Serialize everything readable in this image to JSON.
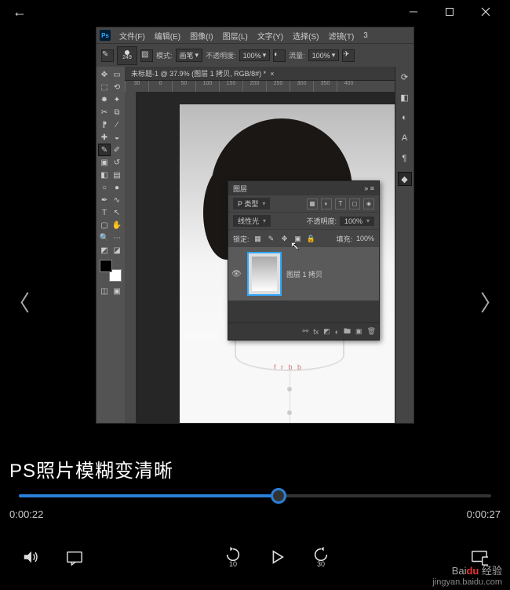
{
  "titlebar": {
    "back_icon": "←"
  },
  "ps": {
    "logo": "Ps",
    "menu": [
      "文件(F)",
      "编辑(E)",
      "图像(I)",
      "图层(L)",
      "文字(Y)",
      "选择(S)",
      "滤镜(T)",
      "3"
    ],
    "options": {
      "brush_size": "249",
      "mode_label": "模式:",
      "mode_value": "画笔",
      "opacity_label": "不透明度:",
      "opacity_value": "100%",
      "flow_label": "流量:",
      "flow_value": "100%"
    },
    "tab": "未标题-1 @ 37.9% (图层 1 拷贝, RGB/8#) *",
    "right_icons": [
      "history-icon",
      "properties-icon",
      "adjust-icon",
      "type-icon",
      "paragraph-icon",
      "layers-icon"
    ],
    "ruler_marks": [
      "30",
      "0",
      "50",
      "100",
      "150",
      "200",
      "250",
      "300",
      "350",
      "400"
    ]
  },
  "layers_panel": {
    "title": "图层",
    "kind_label": "P 类型",
    "blend_mode": "线性光",
    "opacity_label": "不透明度:",
    "opacity_value": "100%",
    "lock_label": "锁定:",
    "fill_label": "填充:",
    "fill_value": "100%",
    "layer_name": "图层 1 拷贝",
    "footer_icons": [
      "link",
      "fx",
      "mask",
      "adjust",
      "group",
      "new",
      "trash"
    ]
  },
  "carousel": {
    "prev_glyph": "〈",
    "next_glyph": "〉"
  },
  "caption": "PS照片模糊变清晰",
  "player": {
    "current_time": "0:00:22",
    "total_time": "0:00:27",
    "progress_pct": 55,
    "skip_back_label": "10",
    "skip_fwd_label": "30"
  },
  "shirt_text": "f r b b",
  "watermark": {
    "line1_a": "Bai",
    "line1_b": "du",
    "line1_c": " 经验",
    "line2": "jingyan.baidu.com"
  }
}
